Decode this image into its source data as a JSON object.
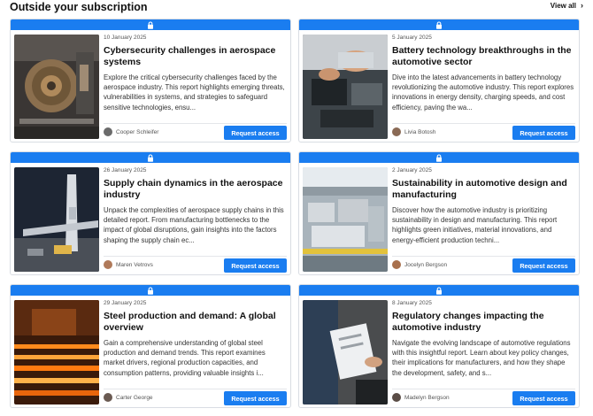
{
  "header": {
    "title": "Outside your subscription",
    "view_all": "View all"
  },
  "cards": [
    {
      "date": "10 January 2025",
      "title": "Cybersecurity challenges in aerospace systems",
      "description": "Explore the critical cybersecurity challenges faced by the aerospace industry. This report highlights emerging threats, vulnerabilities in systems, and strategies to safeguard sensitive technologies, ensu...",
      "author": "Cooper Schleifer",
      "button": "Request access",
      "image": "aerospace-engine-workshop"
    },
    {
      "date": "5 January 2025",
      "title": "Battery technology breakthroughs in the automotive sector",
      "description": "Dive into the latest advancements in battery technology revolutionizing the automotive industry. This report explores innovations in energy density, charging speeds, and cost efficiency, paving the wa...",
      "author": "Livia Botosh",
      "button": "Request access",
      "image": "mechanic-engine-bay"
    },
    {
      "date": "26 January 2025",
      "title": "Supply chain dynamics in the aerospace industry",
      "description": "Unpack the complexities of aerospace supply chains in this detailed report. From manufacturing bottlenecks to the impact of global disruptions, gain insights into the factors shaping the supply chain ec...",
      "author": "Maren Vetrovs",
      "button": "Request access",
      "image": "airplane-tarmac"
    },
    {
      "date": "2 January 2025",
      "title": "Sustainability in automotive design and manufacturing",
      "description": "Discover how the automotive industry is prioritizing sustainability in design and manufacturing. This report highlights green initiatives, material innovations, and energy-efficient production techni...",
      "author": "Jocelyn Bergson",
      "button": "Request access",
      "image": "car-assembly-line"
    },
    {
      "date": "29 January 2025",
      "title": "Steel production and demand: A global overview",
      "description": "Gain a comprehensive understanding of global steel production and demand trends. This report examines market drivers, regional production capacities, and consumption patterns, providing valuable insights i...",
      "author": "Carter George",
      "button": "Request access",
      "image": "steel-mill-hot-bars"
    },
    {
      "date": "8 January 2025",
      "title": "Regulatory changes impacting the automotive industry",
      "description": "Navigate the evolving landscape of automotive regulations with this insightful report. Learn about key policy changes, their implications for manufacturers, and how they shape the development, safety, and s...",
      "author": "Madelyn Bergson",
      "button": "Request access",
      "image": "clipboard-inspection"
    }
  ],
  "colors": {
    "accent": "#1a7df0",
    "border": "#d9dde3"
  },
  "icons": [
    "lock-icon",
    "chevron-right-icon"
  ]
}
